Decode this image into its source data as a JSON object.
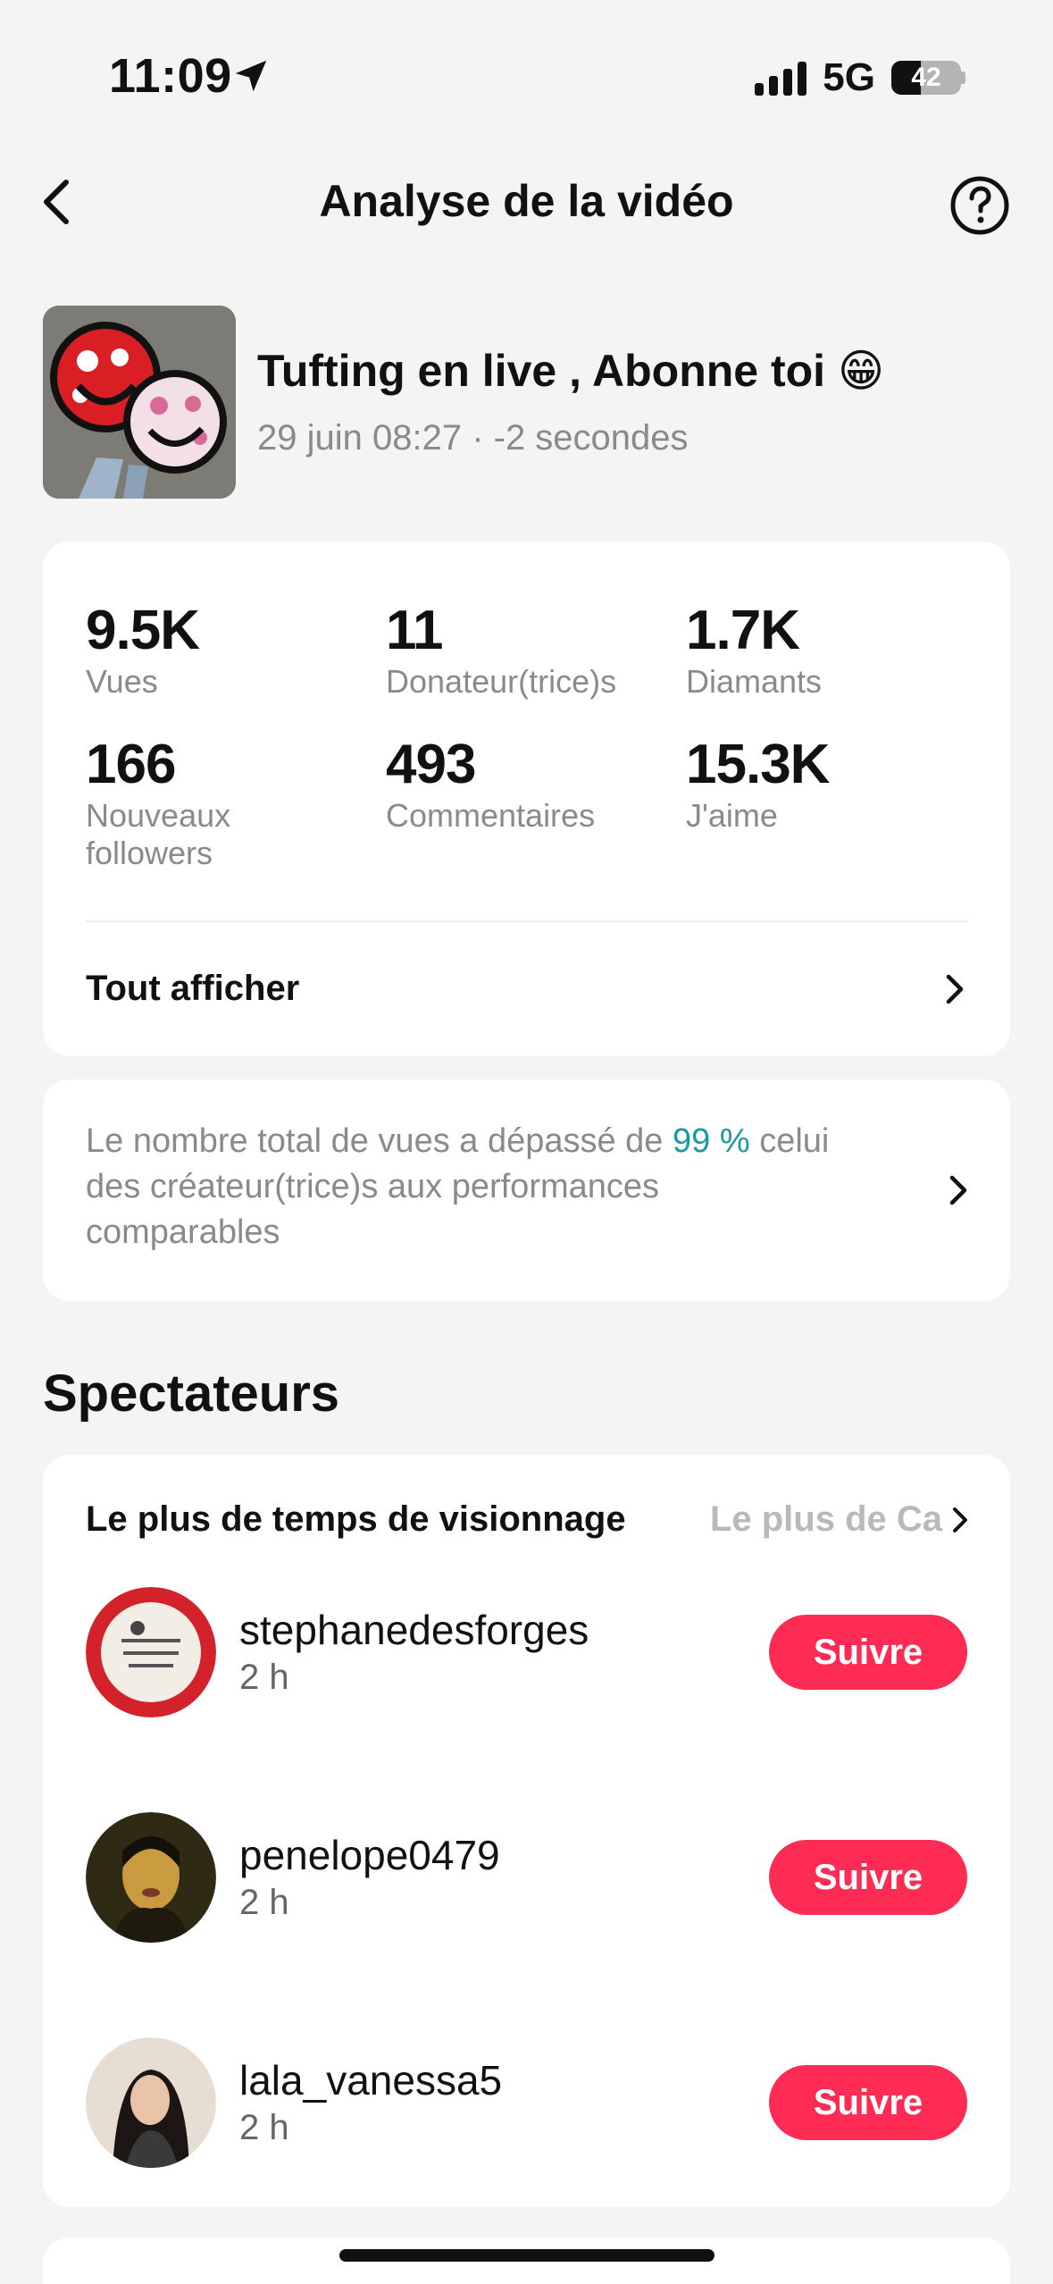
{
  "status_bar": {
    "time": "11:09",
    "network": "5G",
    "battery": "42",
    "battery_fraction": 0.42
  },
  "header": {
    "title": "Analyse de la vidéo",
    "back_icon": "chevron-left-icon",
    "help_icon": "question-circle-icon"
  },
  "video": {
    "title": "Tufting en live , Abonne toi 😁",
    "subtitle": "29 juin 08:27 · -2 secondes"
  },
  "stats": {
    "items": [
      {
        "value": "9.5K",
        "label": "Vues"
      },
      {
        "value": "11",
        "label": "Donateur(trice)s"
      },
      {
        "value": "1.7K",
        "label": "Diamants"
      },
      {
        "value": "166",
        "label": "Nouveaux followers"
      },
      {
        "value": "493",
        "label": "Commentaires"
      },
      {
        "value": "15.3K",
        "label": "J'aime"
      }
    ],
    "show_all": "Tout afficher"
  },
  "performance": {
    "text_before": "Le nombre total de vues a dépassé de ",
    "highlight": "99 %",
    "text_after": " celui des créateur(trice)s aux performances comparables",
    "highlight_color": "#1a9a9f"
  },
  "spectators": {
    "section_title": "Spectateurs",
    "tab_active": "Le plus de temps de visionnage",
    "tab_inactive": "Le plus de Ca",
    "follow_label": "Suivre",
    "follow_color": "#fe2c55",
    "viewers": [
      {
        "name": "stephanedesforges",
        "time": "2 h"
      },
      {
        "name": "penelope0479",
        "time": "2 h"
      },
      {
        "name": "lala_vanessa5",
        "time": "2 h"
      }
    ]
  }
}
